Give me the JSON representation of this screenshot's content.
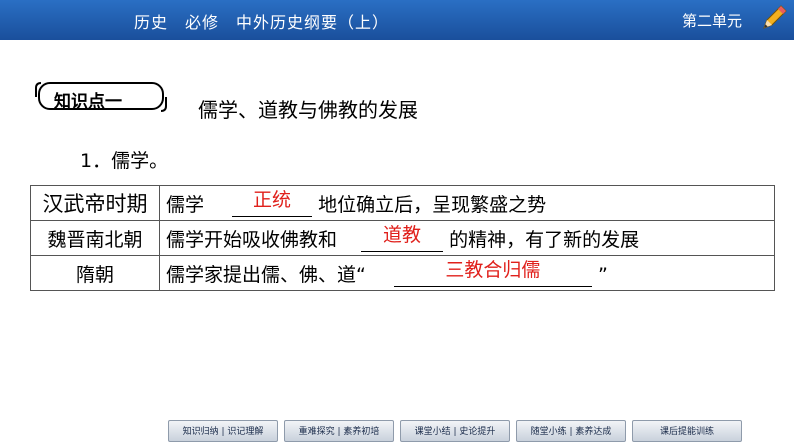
{
  "header": {
    "title": "历史　必修　中外历史纲要（上）",
    "unit": "第二单元"
  },
  "knowledge_point": {
    "label": "知识点一",
    "title": "儒学、道教与佛教的发展"
  },
  "section": {
    "heading": "1．儒学。"
  },
  "table": {
    "rows": [
      {
        "period": "汉武帝时期",
        "before": "儒学",
        "answer": "正统",
        "after": "地位确立后，呈现繁盛之势"
      },
      {
        "period": "魏晋南北朝",
        "before": "儒学开始吸收佛教和",
        "answer": "道教",
        "after": "的精神，有了新的发展"
      },
      {
        "period": "隋朝",
        "before": "儒学家提出儒、佛、道“",
        "answer": "三教合归儒",
        "after": "”"
      }
    ]
  },
  "nav": {
    "items": [
      "知识归纳 | 识记理解",
      "重难探究 | 素养初培",
      "课堂小结 | 史论提升",
      "随堂小练 | 素养达成",
      "课后提能训练"
    ]
  },
  "colors": {
    "header_bg": "#1a4f9c",
    "answer_red": "#e0201b"
  }
}
